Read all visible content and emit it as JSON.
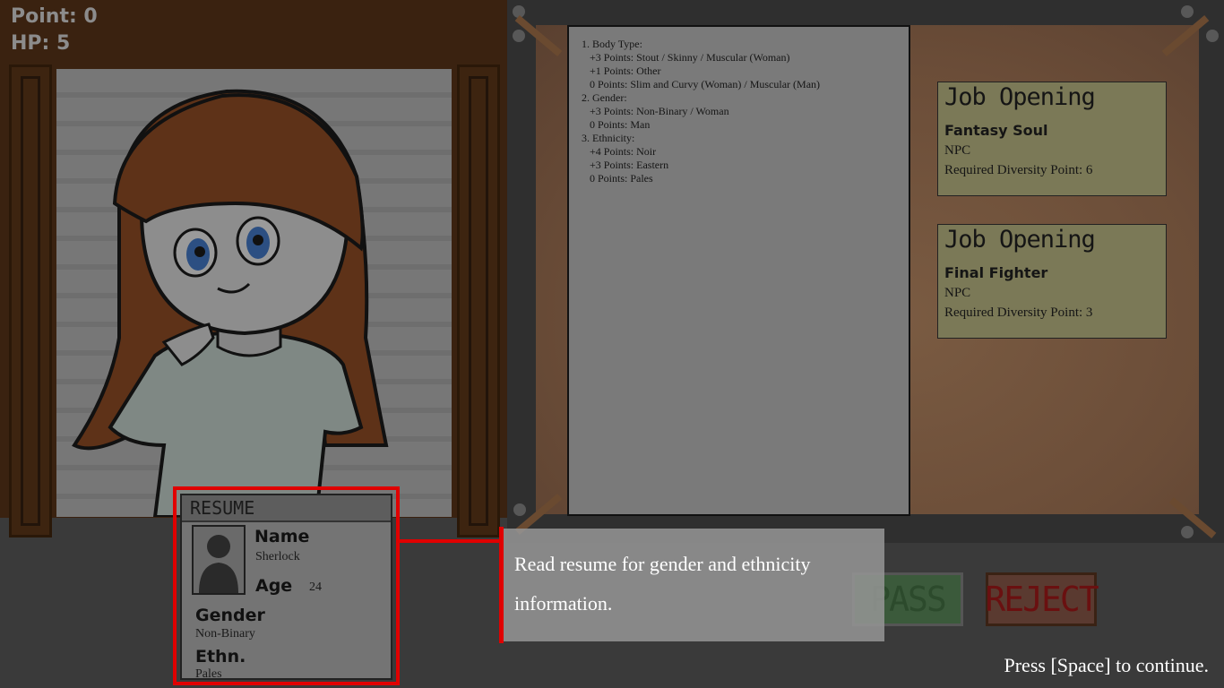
{
  "hud": {
    "point": "Point: 0",
    "hp": "HP: 5"
  },
  "rules": {
    "lines": [
      "1. Body Type:",
      "   +3 Points: Stout / Skinny / Muscular (Woman)",
      "   +1 Points: Other",
      "   0 Points: Slim and Curvy (Woman) / Muscular (Man)",
      "",
      "2. Gender:",
      "   +3 Points: Non-Binary / Woman",
      "   0 Points: Man",
      "",
      "3. Ethnicity:",
      "   +4 Points: Noir",
      "   +3 Points: Eastern",
      "   0 Points: Pales"
    ]
  },
  "jobs": [
    {
      "heading": "Job Opening",
      "name": "Fantasy Soul",
      "role": "NPC",
      "requirement": "Required Diversity Point: 6"
    },
    {
      "heading": "Job Opening",
      "name": "Final Fighter",
      "role": "NPC",
      "requirement": "Required Diversity Point: 3"
    }
  ],
  "buttons": {
    "pass": "PASS",
    "reject": "REJECT"
  },
  "resume": {
    "title": "RESUME",
    "name_label": "Name",
    "name_value": "Sherlock",
    "age_label": "Age",
    "age_value": "24",
    "gender_label": "Gender",
    "gender_value": "Non-Binary",
    "ethn_label": "Ethn.",
    "ethn_value": "Pales"
  },
  "tutorial": {
    "tip": "Read resume for gender and ethnicity information.",
    "continue": "Press [Space] to continue."
  },
  "colors": {
    "highlight": "#e00000",
    "pass": "#3b5a3b",
    "reject": "#6a1010"
  }
}
